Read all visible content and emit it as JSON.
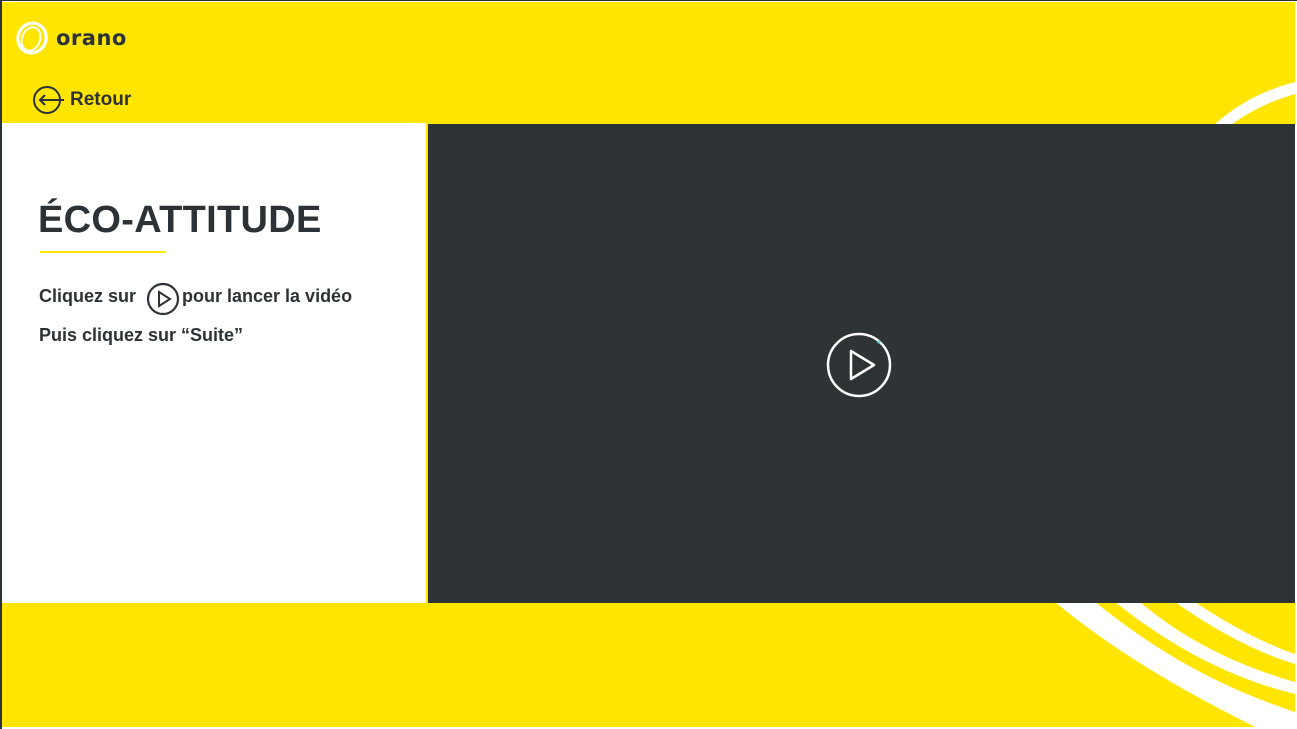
{
  "brand": {
    "name": "orano",
    "color": "#ffe500",
    "dark": "#2c3235"
  },
  "nav": {
    "back_label": "Retour",
    "back_icon": "arrow-left-circle-icon"
  },
  "content": {
    "title": "ÉCO-ATTITUDE",
    "instruction_before": "Cliquez sur",
    "instruction_after": "pour lancer la vidéo",
    "instruction_icon": "play-circle-icon",
    "instruction_next": "Puis cliquez sur “Suite”"
  },
  "video": {
    "background": "#2e3336",
    "play_icon": "play-circle-icon"
  }
}
